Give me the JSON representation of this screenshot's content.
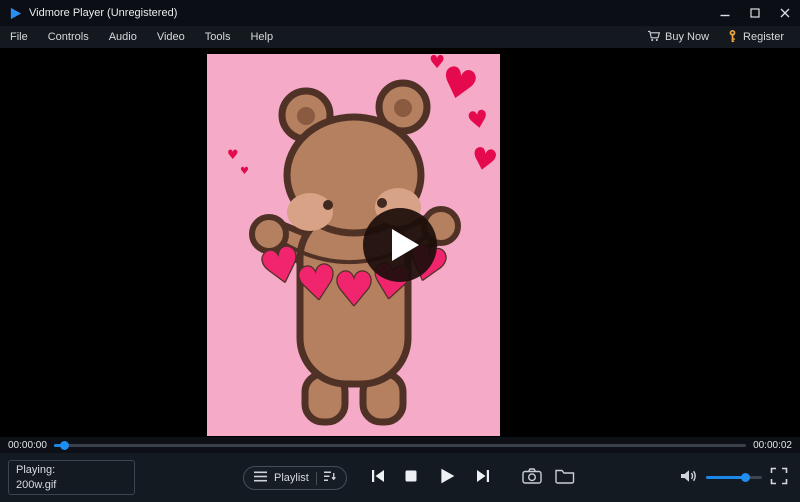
{
  "window": {
    "title": "Vidmore Player (Unregistered)"
  },
  "menu": {
    "items": [
      "File",
      "Controls",
      "Audio",
      "Video",
      "Tools",
      "Help"
    ],
    "buy_now_label": "Buy Now",
    "register_label": "Register"
  },
  "video": {
    "description": "Animated GIF frame: cartoon brown bear holding a garland of pink hearts on a pink background, with a dark play-button overlay centered"
  },
  "seek": {
    "elapsed": "00:00:00",
    "duration": "00:00:02",
    "progress_percent": 1
  },
  "controls": {
    "playing_label": "Playing:",
    "file_name": "200w.gif",
    "playlist_label": "Playlist",
    "volume_percent": 70
  },
  "colors": {
    "accent_blue": "#1b87e6",
    "titlebar_bg": "#0b0e15",
    "controlbar_bg": "#141a22",
    "gif_background_pink": "#f5aac8",
    "garland_heart_pink": "#f1246e",
    "floating_heart_red": "#e40a4d",
    "bear_brown": "#b5805f",
    "bear_outline": "#4f3126",
    "register_key_orange": "#e9a63e"
  },
  "icons": {
    "titlebar": [
      "vidmore-logo-icon",
      "minimize-icon",
      "maximize-icon",
      "close-icon"
    ],
    "menubar": [
      "cart-icon",
      "key-icon"
    ],
    "video": [
      "play-overlay-icon"
    ],
    "controlbar": [
      "playlist-list-icon",
      "play-order-icon",
      "skip-previous-icon",
      "stop-icon",
      "play-icon",
      "skip-next-icon",
      "snapshot-camera-icon",
      "open-folder-icon",
      "volume-speaker-icon",
      "fullscreen-icon"
    ]
  }
}
